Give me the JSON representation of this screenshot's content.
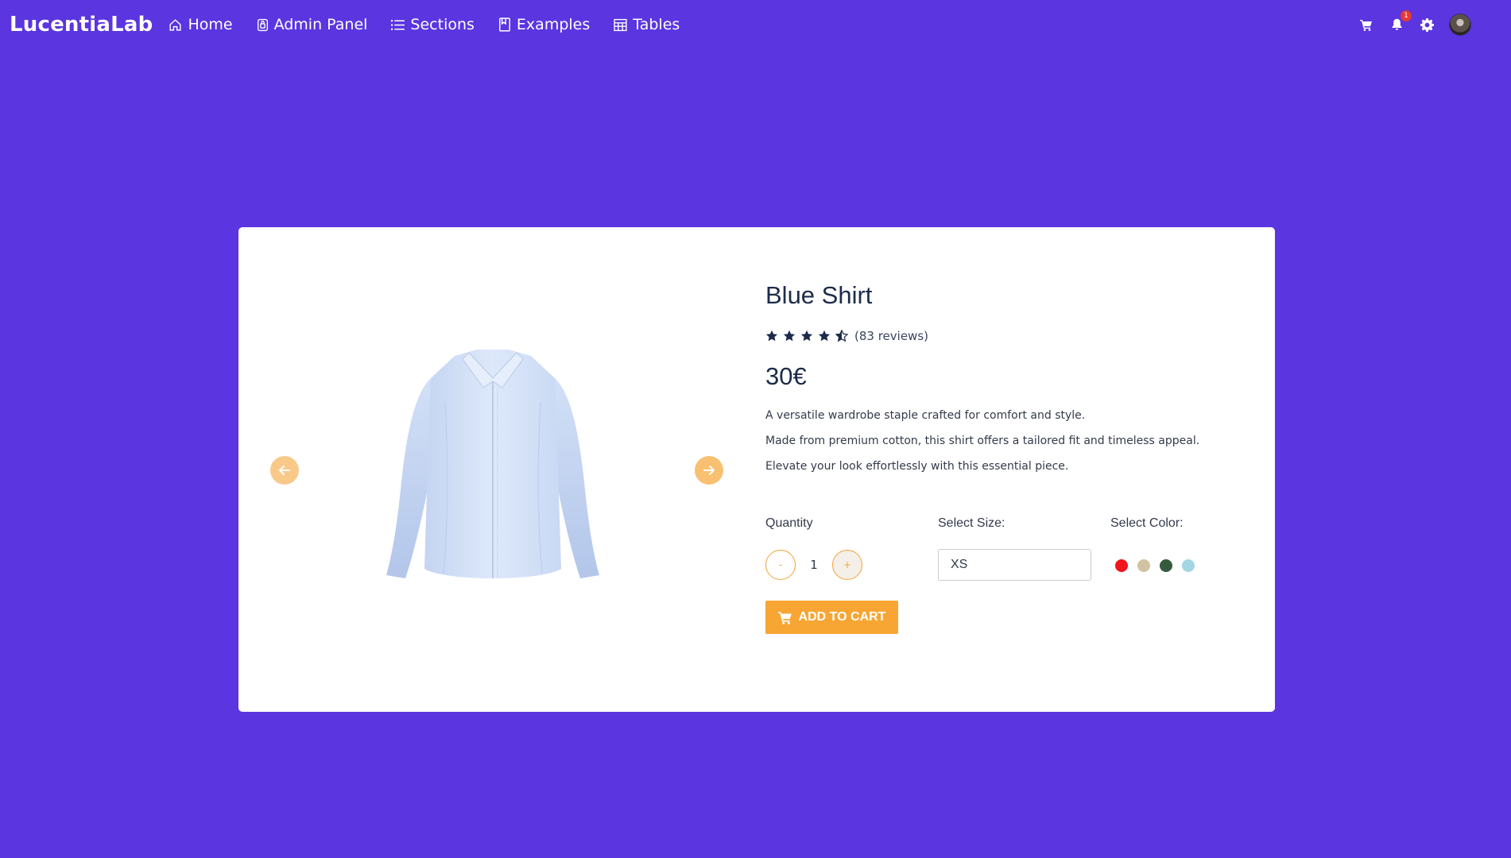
{
  "navbar": {
    "brand": "LucentiaLab",
    "links": [
      {
        "label": "Home",
        "icon": "home-icon"
      },
      {
        "label": "Admin Panel",
        "icon": "lock-icon"
      },
      {
        "label": "Sections",
        "icon": "list-icon"
      },
      {
        "label": "Examples",
        "icon": "notebook-icon"
      },
      {
        "label": "Tables",
        "icon": "table-icon"
      }
    ],
    "notification_count": "1"
  },
  "product": {
    "title": "Blue Shirt",
    "rating": 4.5,
    "reviews": "(83 reviews)",
    "price": "30€",
    "description": [
      "A versatile wardrobe staple crafted for comfort and style.",
      "Made from premium cotton, this shirt offers a tailored fit and timeless appeal.",
      "Elevate your look effortlessly with this essential piece."
    ],
    "quantity_label": "Quantity",
    "quantity_minus": "-",
    "quantity_value": "1",
    "quantity_plus": "+",
    "size_label": "Select Size:",
    "size_value": "XS",
    "color_label": "Select Color:",
    "colors": [
      "#f0151b",
      "#d1c3a2",
      "#365a3e",
      "#a4d5e2"
    ],
    "add_to_cart": "ADD TO CART"
  },
  "colors": {
    "background": "#5a35e0",
    "accent": "#f7a633",
    "text_dark": "#1c2b4a"
  }
}
